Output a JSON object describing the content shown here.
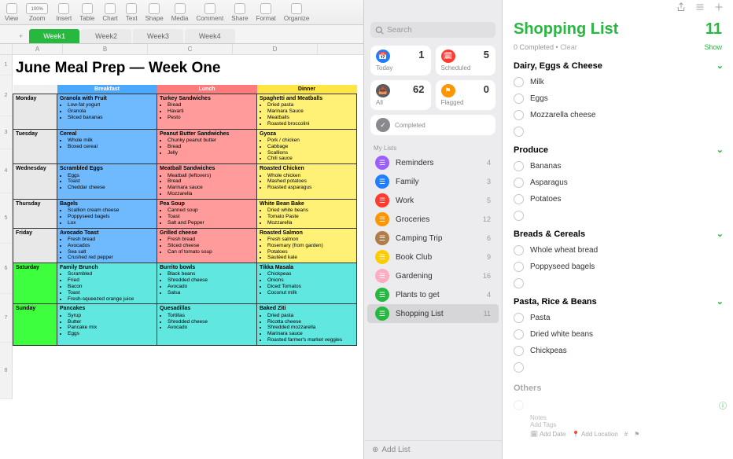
{
  "toolbar": {
    "items": [
      "View",
      "Zoom",
      "Insert",
      "Table",
      "Chart",
      "Text",
      "Shape",
      "Media",
      "Comment",
      "Share",
      "Format",
      "Organize"
    ],
    "zoom": "100%"
  },
  "tabs": [
    "Week1",
    "Week2",
    "Week3",
    "Week4"
  ],
  "columns": [
    "A",
    "B",
    "C",
    "D"
  ],
  "rows": [
    "1",
    "2",
    "3",
    "4",
    "5",
    "6",
    "7",
    "8"
  ],
  "docTitle": "June Meal Prep — Week One",
  "headers": {
    "breakfast": "Breakfast",
    "lunch": "Lunch",
    "dinner": "Dinner"
  },
  "days": [
    {
      "name": "Monday",
      "wkend": false,
      "b": {
        "t": "Granola with Fruit",
        "i": [
          "Low-fat yogurt",
          "Granola",
          "Sliced bananas"
        ]
      },
      "l": {
        "t": "Turkey Sandwiches",
        "i": [
          "Bread",
          "Havarti",
          "Pesto"
        ]
      },
      "d": {
        "t": "Spaghetti and Meatballs",
        "i": [
          "Dried pasta",
          "Marinara Sauce",
          "Meatballs",
          "Roasted broccolini"
        ]
      }
    },
    {
      "name": "Tuesday",
      "wkend": false,
      "b": {
        "t": "Cereal",
        "i": [
          "Whole milk",
          "Boxed cereal"
        ]
      },
      "l": {
        "t": "Peanut Butter Sandwiches",
        "i": [
          "Chunky peanut butter",
          "Bread",
          "Jelly"
        ]
      },
      "d": {
        "t": "Gyoza",
        "i": [
          "Pork / chicken",
          "Cabbage",
          "Scallions",
          "Chili sauce"
        ]
      }
    },
    {
      "name": "Wednesday",
      "wkend": false,
      "b": {
        "t": "Scrambled Eggs",
        "i": [
          "Eggs",
          "Toast",
          "Cheddar cheese"
        ]
      },
      "l": {
        "t": "Meatball Sandwiches",
        "i": [
          "Meatball (leftovers)",
          "Bread",
          "Marinara sauce",
          "Mozzarella"
        ]
      },
      "d": {
        "t": "Roasted Chicken",
        "i": [
          "Whole chicken",
          "Mashed potatoes",
          "Roasted asparagus"
        ]
      }
    },
    {
      "name": "Thursday",
      "wkend": false,
      "b": {
        "t": "Bagels",
        "i": [
          "Scallion cream cheese",
          "Poppyseed bagels",
          "Lox"
        ]
      },
      "l": {
        "t": "Pea Soup",
        "i": [
          "Canned soup",
          "Toast",
          "Salt and Pepper"
        ]
      },
      "d": {
        "t": "White Bean Bake",
        "i": [
          "Dried white beans",
          "Tomato Paste",
          "Mozzarella"
        ]
      }
    },
    {
      "name": "Friday",
      "wkend": false,
      "b": {
        "t": "Avocado Toast",
        "i": [
          "Fresh bread",
          "Avocados",
          "Sea salt",
          "Crushed red pepper"
        ]
      },
      "l": {
        "t": "Grilled cheese",
        "i": [
          "Fresh bread",
          "Sliced cheese",
          "Can of tomato soup"
        ]
      },
      "d": {
        "t": "Roasted Salmon",
        "i": [
          "Fresh salmon",
          "Rosemary (from garden)",
          "Potatoes",
          "Sautéed kale"
        ]
      }
    },
    {
      "name": "Saturday",
      "wkend": true,
      "b": {
        "t": "Family Brunch",
        "i": [
          "Scrambled",
          "Fried",
          "Bacon",
          "Toast",
          "Fresh-squeezed orange juice"
        ]
      },
      "l": {
        "t": "Burrito bowls",
        "i": [
          "Black beans",
          "Shredded cheese",
          "Avocado",
          "Salsa"
        ]
      },
      "d": {
        "t": "Tikka Masala",
        "i": [
          "Chickpeas",
          "Onions",
          "Diced Tomatos",
          "Coconut milk"
        ]
      }
    },
    {
      "name": "Sunday",
      "wkend": true,
      "b": {
        "t": "Pancakes",
        "i": [
          "Syrup",
          "Butter",
          "Pancake mix",
          "Eggs"
        ]
      },
      "l": {
        "t": "Quesadillas",
        "i": [
          "Tortillas",
          "Shredded cheese",
          "Avocado"
        ]
      },
      "d": {
        "t": "Baked Ziti",
        "i": [
          "Dried pasta",
          "Ricotta cheese",
          "Shredded mozzarella",
          "Marinara sauce",
          "Roasted farmer's market veggies"
        ]
      }
    }
  ],
  "reminders": {
    "searchPlaceholder": "Search",
    "smart": [
      {
        "label": "Today",
        "count": 1,
        "color": "#1f7eff",
        "icon": "📅"
      },
      {
        "label": "Scheduled",
        "count": 5,
        "color": "#ff3b30",
        "icon": "🗓"
      },
      {
        "label": "All",
        "count": 62,
        "color": "#5b5b5f",
        "icon": "📥"
      },
      {
        "label": "Flagged",
        "count": 0,
        "color": "#ff9500",
        "icon": "⚑"
      }
    ],
    "completedLabel": "Completed",
    "myListsLabel": "My Lists",
    "lists": [
      {
        "name": "Reminders",
        "count": 4,
        "color": "#9b5fff"
      },
      {
        "name": "Family",
        "count": 3,
        "color": "#1f7eff"
      },
      {
        "name": "Work",
        "count": 5,
        "color": "#ff3b30"
      },
      {
        "name": "Groceries",
        "count": 12,
        "color": "#ff9500"
      },
      {
        "name": "Camping Trip",
        "count": 6,
        "color": "#b07d4a"
      },
      {
        "name": "Book Club",
        "count": 9,
        "color": "#ffcc00"
      },
      {
        "name": "Gardening",
        "count": 16,
        "color": "#ffabc0"
      },
      {
        "name": "Plants to get",
        "count": 4,
        "color": "#27b840"
      },
      {
        "name": "Shopping List",
        "count": 11,
        "color": "#27b840"
      }
    ],
    "addListLabel": "Add List"
  },
  "detail": {
    "title": "Shopping List",
    "count": "11",
    "completedText": "0 Completed",
    "clearLabel": "Clear",
    "showLabel": "Show",
    "sections": [
      {
        "name": "Dairy, Eggs & Cheese",
        "items": [
          "Milk",
          "Eggs",
          "Mozzarella cheese"
        ]
      },
      {
        "name": "Produce",
        "items": [
          "Bananas",
          "Asparagus",
          "Potatoes"
        ]
      },
      {
        "name": "Breads & Cereals",
        "items": [
          "Whole wheat bread",
          "Poppyseed bagels"
        ]
      },
      {
        "name": "Pasta, Rice & Beans",
        "items": [
          "Pasta",
          "Dried white beans",
          "Chickpeas"
        ]
      }
    ],
    "othersLabel": "Others",
    "notesLabel": "Notes",
    "tagsLabel": "Add Tags",
    "addDate": "Add Date",
    "addLoc": "Add Location"
  }
}
